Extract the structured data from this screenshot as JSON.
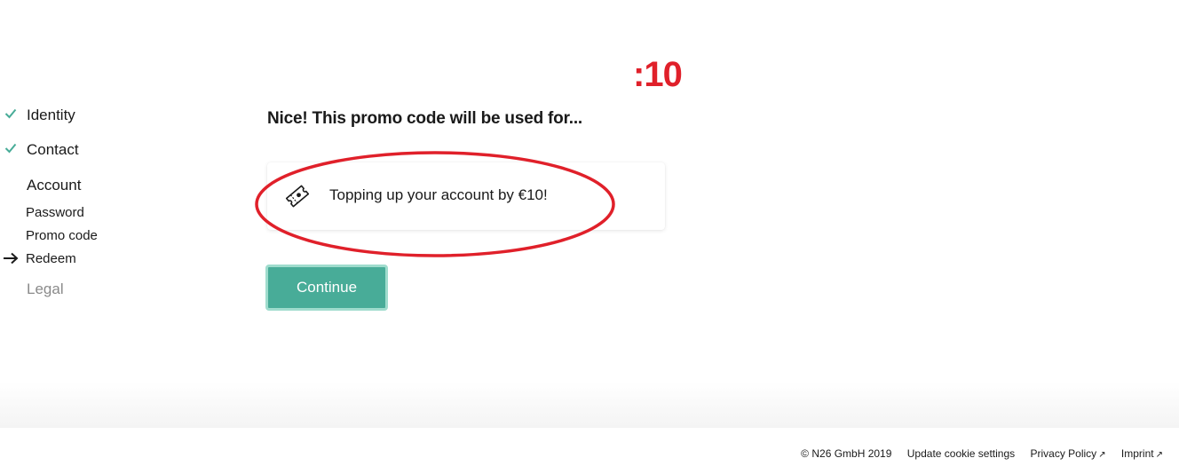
{
  "annotation": {
    "text": ":10",
    "color": "#e0202a"
  },
  "sidebar": {
    "steps": [
      {
        "label": "Identity",
        "status": "complete"
      },
      {
        "label": "Contact",
        "status": "complete"
      },
      {
        "label": "Account",
        "status": "active"
      }
    ],
    "substeps": [
      {
        "label": "Password"
      },
      {
        "label": "Promo code"
      },
      {
        "label": "Redeem",
        "current": true
      }
    ],
    "legal": {
      "label": "Legal",
      "status": "pending"
    }
  },
  "main": {
    "headline": "Nice! This promo code will be used for...",
    "promo": {
      "icon": "ticket-icon",
      "text": "Topping up your account by €10!"
    },
    "continue_label": "Continue"
  },
  "footer": {
    "copyright": "© N26 GmbH 2019",
    "cookie_settings": "Update cookie settings",
    "privacy_policy": "Privacy Policy",
    "imprint": "Imprint",
    "external_icon": "↗"
  },
  "colors": {
    "accent": "#48ac98",
    "check": "#48ac98",
    "annotation_red": "#e0202a"
  }
}
